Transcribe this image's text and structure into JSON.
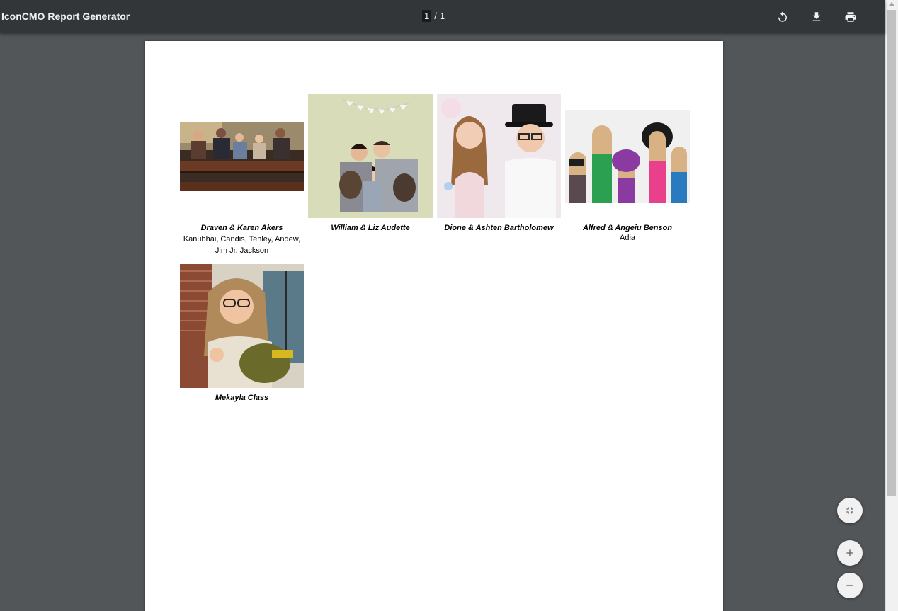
{
  "toolbar": {
    "title": "IconCMO Report Generator",
    "page_current": "1",
    "page_separator": "/",
    "page_total": "1",
    "icons": {
      "rotate": "rotate-icon",
      "download": "download-icon",
      "print": "print-icon"
    }
  },
  "families": [
    {
      "name": "Draven & Karen Akers",
      "children_line1": "Kanubhai, Candis, Tenley, Andew,",
      "children_line2": "Jim Jr. Jackson"
    },
    {
      "name": "William & Liz Audette"
    },
    {
      "name": "Dione & Ashten Bartholomew"
    },
    {
      "name": "Alfred & Angeiu Benson",
      "children_line1": "Adia"
    },
    {
      "name": "Mekayla Class"
    }
  ],
  "zoom_controls": {
    "fit": "fit-to-page-icon",
    "zoom_in": "zoom-in-icon",
    "zoom_out": "zoom-out-icon"
  },
  "colors": {
    "toolbar_bg": "#323639",
    "viewer_bg": "#525659",
    "page_bg": "#ffffff"
  }
}
